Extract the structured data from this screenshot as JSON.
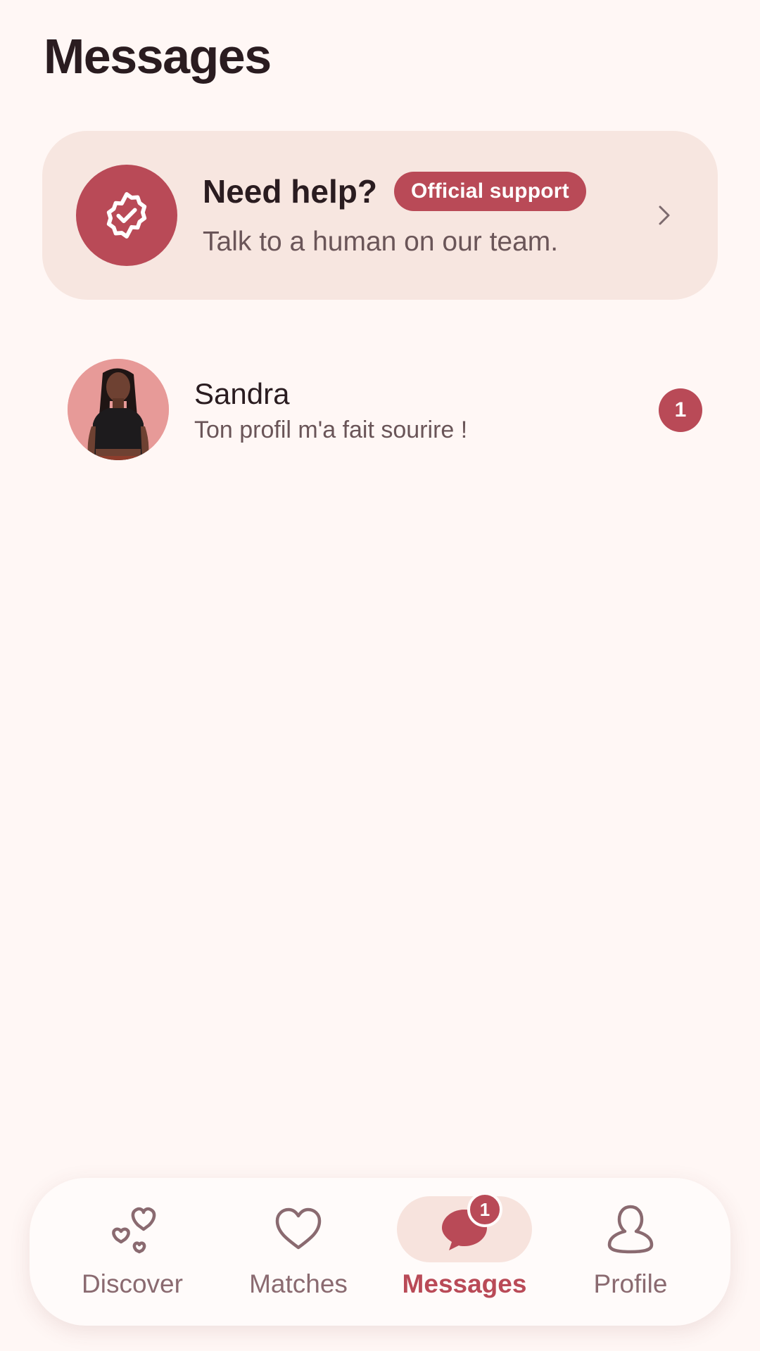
{
  "header": {
    "title": "Messages"
  },
  "support_card": {
    "title": "Need help?",
    "badge": "Official support",
    "subtitle": "Talk to a human on our team.",
    "icon": "verified-badge-icon",
    "chevron_icon": "chevron-right-icon"
  },
  "conversations": [
    {
      "name": "Sandra",
      "preview": "Ton profil m'a fait sourire !",
      "unread": "1",
      "avatar": "sandra-photo"
    }
  ],
  "bottom_nav": {
    "items": [
      {
        "label": "Discover",
        "icon": "hearts-icon",
        "active": false
      },
      {
        "label": "Matches",
        "icon": "heart-icon",
        "active": false
      },
      {
        "label": "Messages",
        "icon": "chat-bubble-icon",
        "active": true,
        "badge": "1"
      },
      {
        "label": "Profile",
        "icon": "person-icon",
        "active": false
      }
    ]
  },
  "colors": {
    "accent": "#b94a57",
    "background": "#fff7f5",
    "card": "#f7e6e0",
    "muted_text": "#6a5558",
    "nav_inactive": "#8a6a70"
  }
}
